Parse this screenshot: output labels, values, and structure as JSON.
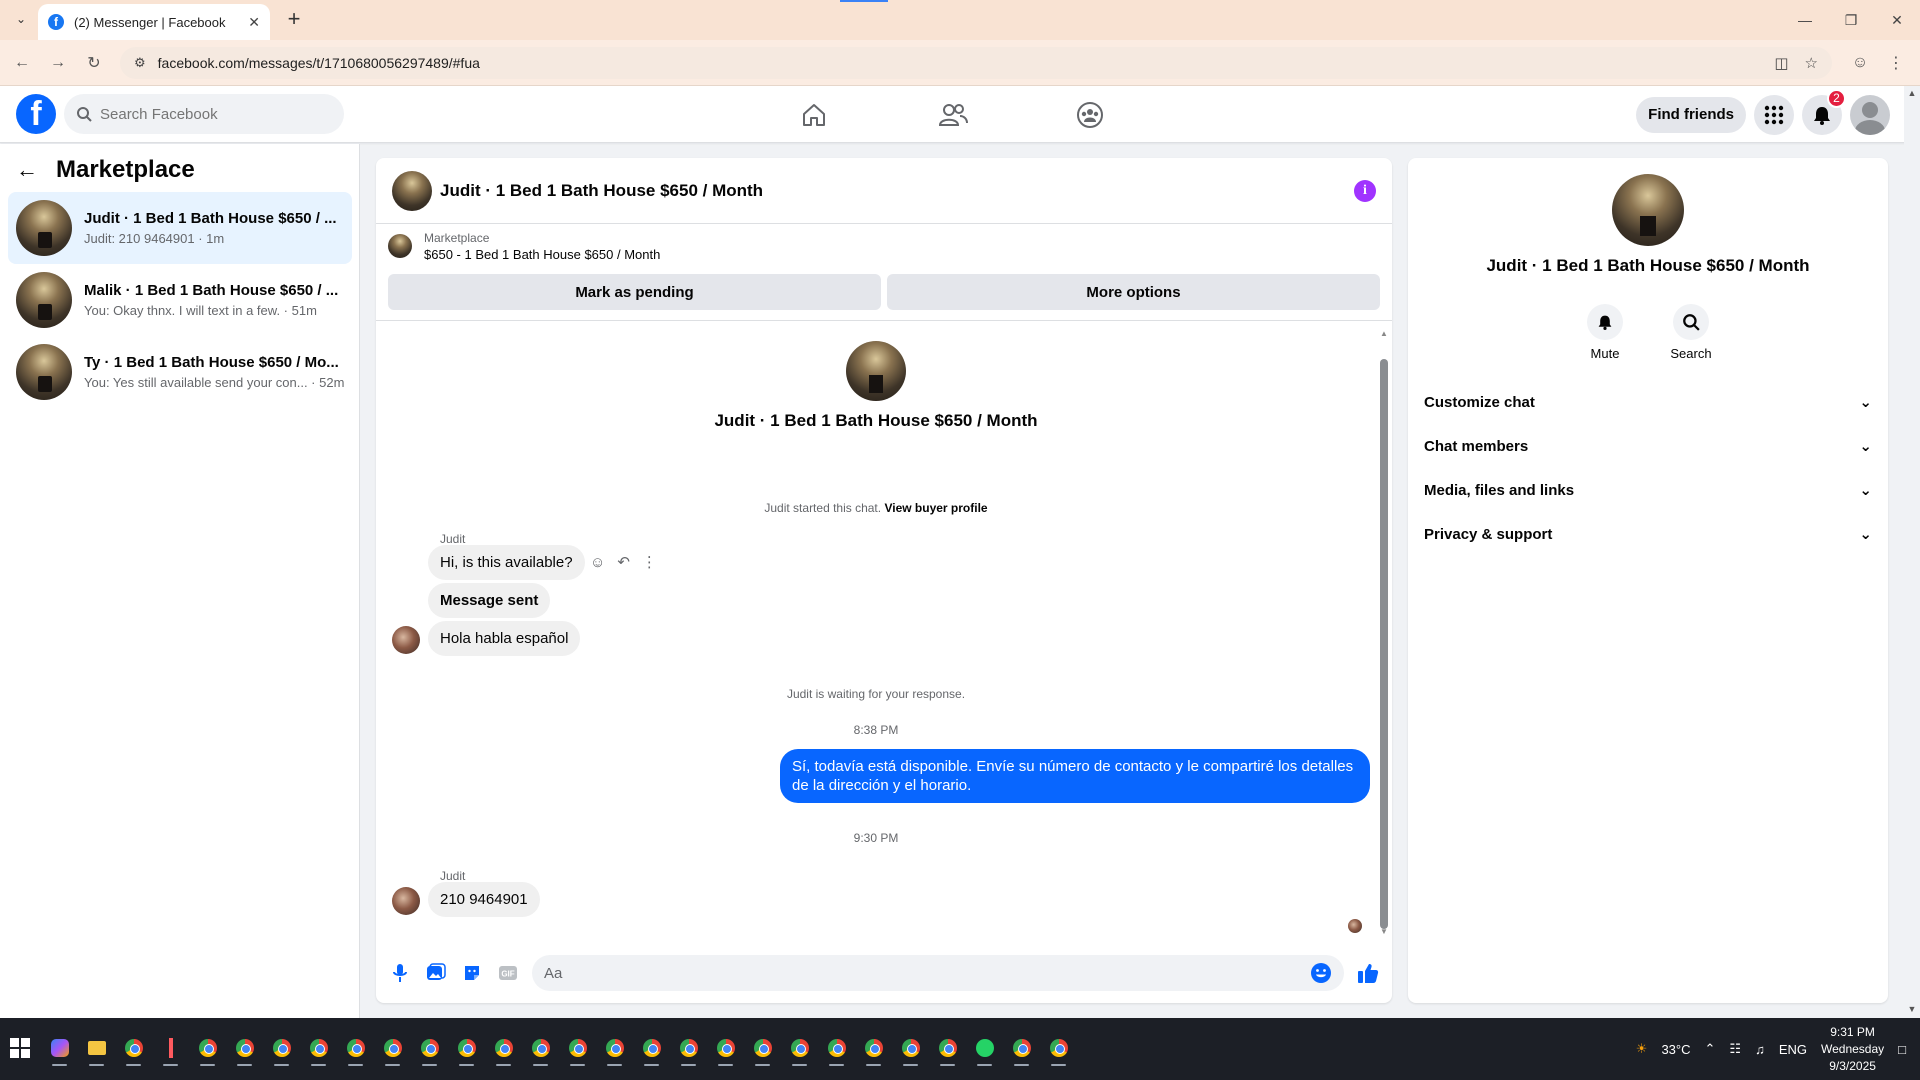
{
  "browser": {
    "tab_title": "(2) Messenger | Facebook",
    "url": "facebook.com/messages/t/1710680056297489/#fua"
  },
  "header": {
    "search_placeholder": "Search Facebook",
    "find_friends": "Find friends",
    "notification_count": "2",
    "accent_color": "#0866ff"
  },
  "sidebar": {
    "title": "Marketplace",
    "conversations": [
      {
        "name": "Judit · 1 Bed 1 Bath House $650 / ...",
        "preview": "Judit: 210 9464901 · 1m"
      },
      {
        "name": "Malik · 1 Bed 1 Bath House $650 / ...",
        "preview": "You: Okay thnx. I will text in a few. · 51m"
      },
      {
        "name": "Ty · 1 Bed 1 Bath House $650 / Mo...",
        "preview": "You: Yes still available send your con... · 52m"
      }
    ]
  },
  "chat": {
    "title": "Judit · 1 Bed 1 Bath House $650 / Month",
    "listing_source": "Marketplace",
    "listing_name": "$650 - 1 Bed 1 Bath House $650 / Month",
    "mark_pending": "Mark as pending",
    "more_options": "More options",
    "thread_title": "Judit · 1 Bed 1 Bath House $650 / Month",
    "started_note": "Judit started this chat.",
    "view_buyer": "View buyer profile",
    "sender1": "Judit",
    "msg1": "Hi, is this available?",
    "msg2": "Message sent",
    "msg3": "Hola habla español",
    "waiting_note": "Judit is waiting for your response.",
    "time1": "8:38 PM",
    "msg4": "Sí, todavía está disponible. Envíe su número de contacto y le compartiré los detalles de la dirección y el horario.",
    "time2": "9:30 PM",
    "sender2": "Judit",
    "msg5": "210 9464901",
    "composer_placeholder": "Aa"
  },
  "right_panel": {
    "title": "Judit · 1 Bed 1 Bath House $650 / Month",
    "mute": "Mute",
    "search": "Search",
    "sections": [
      "Customize chat",
      "Chat members",
      "Media, files and links",
      "Privacy & support"
    ]
  },
  "taskbar": {
    "temperature": "33°C",
    "language": "ENG",
    "time": "9:31 PM",
    "day": "Wednesday",
    "date": "9/3/2025"
  }
}
